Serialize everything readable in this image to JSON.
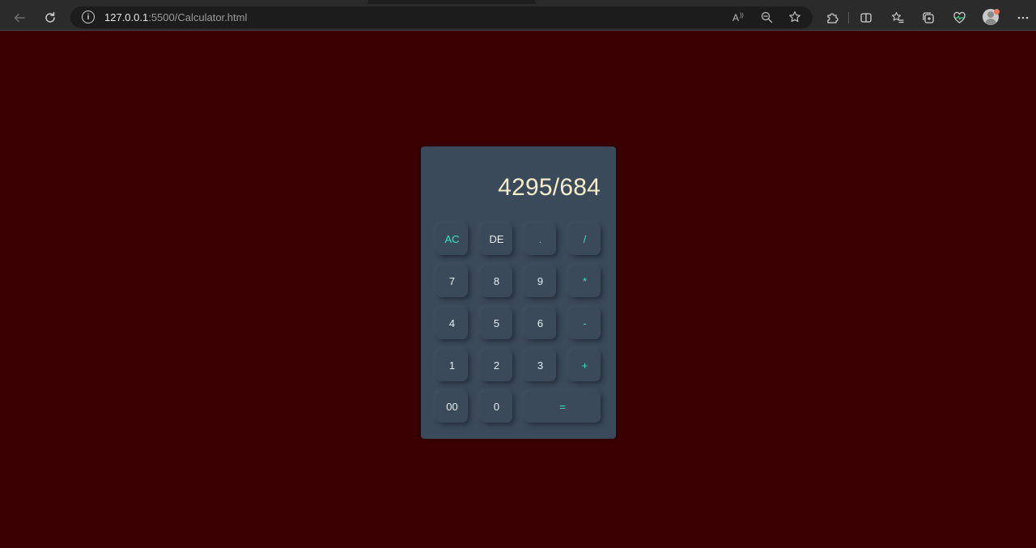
{
  "browser": {
    "url_host": "127.0.0.1",
    "url_path": ":5500/Calculator.html",
    "icons": {
      "back": "back-arrow-icon",
      "refresh": "refresh-icon",
      "info": "info-icon",
      "read_aloud": "read-aloud-icon",
      "zoom": "zoom-out-icon",
      "favorite": "star-icon",
      "extensions": "puzzle-icon",
      "split": "split-screen-icon",
      "favorites": "favorites-icon",
      "collections": "collections-icon",
      "health": "heart-pulse-icon",
      "profile": "profile-avatar",
      "menu": "more-menu-icon"
    }
  },
  "calculator": {
    "display": "4295/684",
    "buttons": {
      "ac": "AC",
      "de": "DE",
      "dot": ".",
      "divide": "/",
      "seven": "7",
      "eight": "8",
      "nine": "9",
      "multiply": "*",
      "four": "4",
      "five": "5",
      "six": "6",
      "minus": "-",
      "one": "1",
      "two": "2",
      "three": "3",
      "plus": "+",
      "double_zero": "00",
      "zero": "0",
      "equals": "="
    }
  },
  "colors": {
    "page_background": "#3a0002",
    "calculator_body": "#3b4a5b",
    "operator_accent": "#38e2c8",
    "display_text": "#f5ecc8"
  }
}
